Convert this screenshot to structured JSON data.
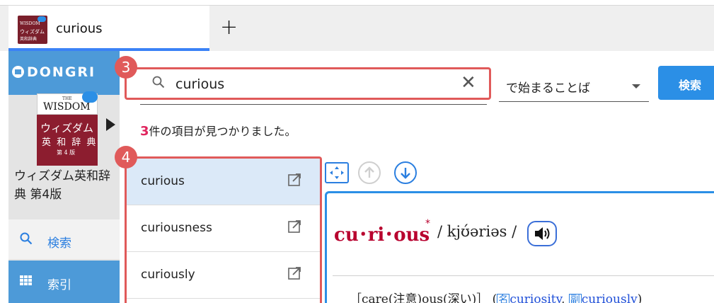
{
  "tab": {
    "title": "curious",
    "icon": {
      "line1": "WISDOM",
      "line2": "ウィズダム",
      "line3": "英和辞典"
    },
    "new_tab": "+"
  },
  "sidebar": {
    "logo": "DONGRI",
    "book_cover": {
      "the": "THE",
      "wisdom": "WISDOM",
      "title": "ウィズダム",
      "subtitle": "英 和 辞 典",
      "edition": "第 4 版"
    },
    "book_name": "ウィズダム英和辞典 第4版",
    "nav": [
      {
        "label": "検索",
        "icon": "search-icon"
      },
      {
        "label": "索引",
        "icon": "grid-icon"
      }
    ]
  },
  "search": {
    "value": "curious",
    "clear": "✕",
    "mode": "で始まることば",
    "button": "検索"
  },
  "results": {
    "count": "3",
    "suffix": "件の項目が見つかりました。"
  },
  "badges": {
    "search": "3",
    "list": "4"
  },
  "word_list": [
    {
      "word": "curious",
      "selected": true
    },
    {
      "word": "curiousness",
      "selected": false
    },
    {
      "word": "curiously",
      "selected": false
    }
  ],
  "entry": {
    "headword": "cu･ri･ous",
    "star": "*",
    "pronunciation": "/ kjʊ́əriəs /",
    "etym_open": "［care(注意)ous(深い)］ (",
    "pos1": "名",
    "link1": "curiosity",
    "sep": ", ",
    "pos2": "副",
    "link2": "curiously",
    "etym_close": ")"
  },
  "colors": {
    "accent": "#2b8fe6",
    "highlight": "#e05a5a",
    "headword": "#b8002e",
    "sidebar": "#4d9ad8"
  }
}
